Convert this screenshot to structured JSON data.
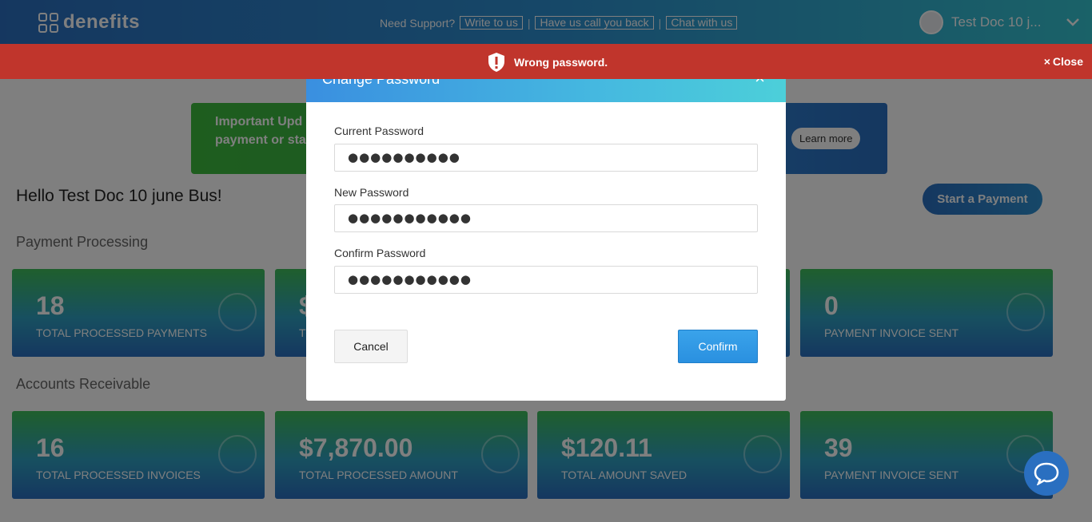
{
  "app": {
    "logo_text": "denefits",
    "support_label": "Need Support?",
    "support_links": [
      "Write to us",
      "Have us call you back",
      "Chat with us"
    ],
    "user_name": "Test Doc 10 j..."
  },
  "promo": {
    "text": "Important Upd and more pow payment or sta",
    "learn_more": "Learn more"
  },
  "greeting": "Hello Test Doc 10 june Bus!",
  "start_payment": "Start a Payment",
  "sections": {
    "payment_processing": "Payment Processing",
    "accounts_receivable": "Accounts Receivable"
  },
  "payment_stats": [
    {
      "value": "18",
      "label": "TOTAL PROCESSED PAYMENTS"
    },
    {
      "value": "$",
      "label": "TO"
    },
    {
      "value": "",
      "label": ""
    },
    {
      "value": "0",
      "label": "PAYMENT INVOICE SENT"
    }
  ],
  "receivable_stats": [
    {
      "value": "16",
      "label": "TOTAL PROCESSED INVOICES"
    },
    {
      "value": "$7,870.00",
      "label": "TOTAL PROCESSED AMOUNT"
    },
    {
      "value": "$120.11",
      "label": "TOTAL AMOUNT SAVED"
    },
    {
      "value": "39",
      "label": "PAYMENT INVOICE SENT"
    }
  ],
  "modal": {
    "title": "Change Password",
    "close": "×",
    "current_label": "Current Password",
    "current_value": "●●●●●●●●●●",
    "new_label": "New Password",
    "new_value": "●●●●●●●●●●●",
    "confirm_label": "Confirm Password",
    "confirm_value": "●●●●●●●●●●●",
    "cancel": "Cancel",
    "confirm": "Confirm"
  },
  "banner": {
    "message": "Wrong password.",
    "close": "Close",
    "color": "#c0352c"
  },
  "icons": {
    "error": "shield-alert-icon",
    "chat": "chat-bubble-icon"
  }
}
